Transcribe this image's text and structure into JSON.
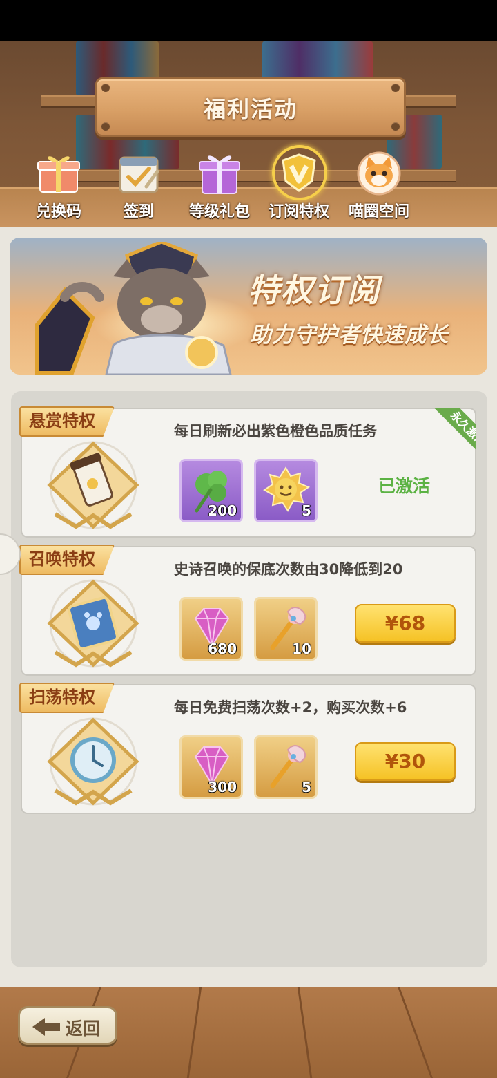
{
  "header": {
    "title": "福利活动",
    "tabs": [
      {
        "label": "兑换码",
        "icon": "gift-box-icon"
      },
      {
        "label": "签到",
        "icon": "calendar-check-icon"
      },
      {
        "label": "等级礼包",
        "icon": "purple-gift-icon"
      },
      {
        "label": "订阅特权",
        "icon": "v-shield-icon",
        "active": true
      },
      {
        "label": "喵圈空间",
        "icon": "cat-face-icon"
      }
    ]
  },
  "banner": {
    "title": "特权订阅",
    "subtitle": "助力守护者快速成长"
  },
  "privileges": [
    {
      "name": "悬赏特权",
      "description": "每日刷新必出紫色橙色品质任务",
      "badge": "永久激活",
      "rewards": [
        {
          "icon": "clover-leaf-icon",
          "count": "200",
          "style": "purple"
        },
        {
          "icon": "sun-badge-icon",
          "count": "5",
          "style": "purple"
        }
      ],
      "status": "已激活"
    },
    {
      "name": "召唤特权",
      "description": "史诗召唤的保底次数由30降低到20",
      "rewards": [
        {
          "icon": "pink-gem-icon",
          "count": "680",
          "style": "gold"
        },
        {
          "icon": "magic-wand-icon",
          "count": "10",
          "style": "gold"
        }
      ],
      "price": "¥68"
    },
    {
      "name": "扫荡特权",
      "description": "每日免费扫荡次数+2，购买次数+6",
      "rewards": [
        {
          "icon": "pink-gem-icon",
          "count": "300",
          "style": "gold"
        },
        {
          "icon": "magic-wand-icon",
          "count": "5",
          "style": "gold"
        }
      ],
      "price": "¥30"
    }
  ],
  "footer": {
    "back_label": "返回"
  }
}
